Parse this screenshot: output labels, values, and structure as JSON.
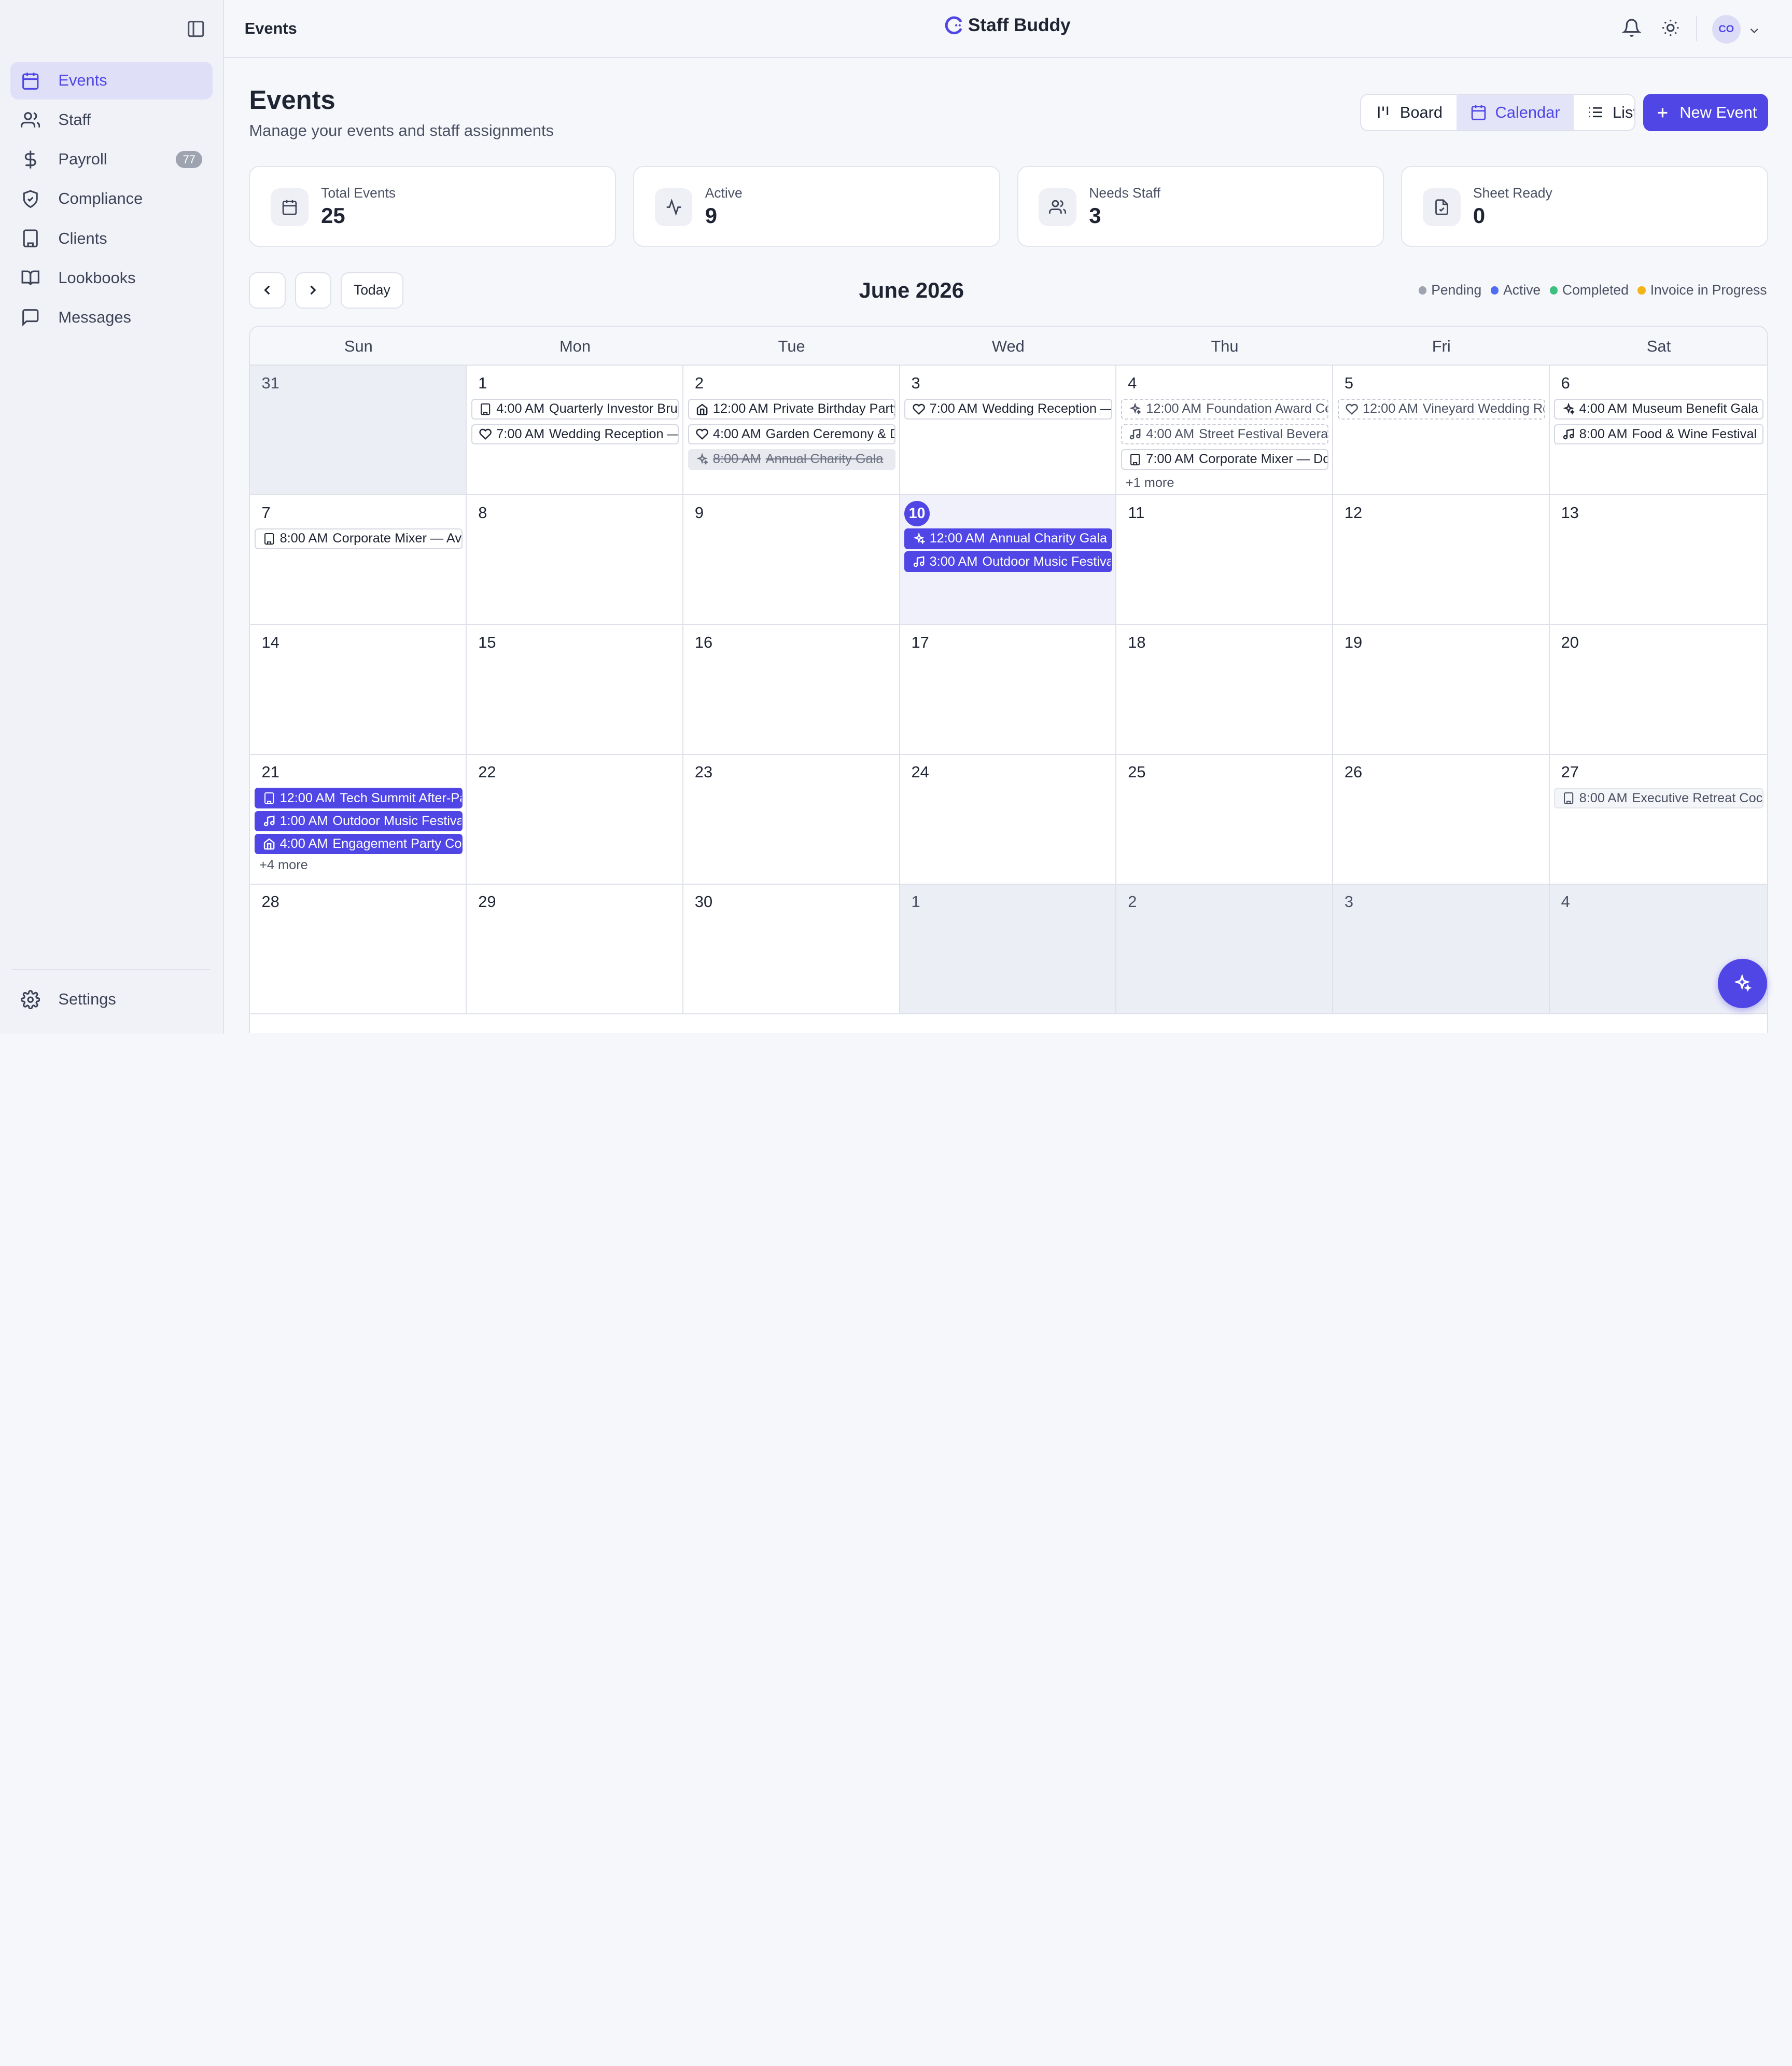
{
  "app": {
    "brand": "Staff Buddy",
    "breadcrumb": "Events",
    "user_initials": "CO"
  },
  "colors": {
    "accent": "#4f46e5",
    "pending": "#9ea3b0",
    "active": "#4f6ef5",
    "completed": "#3fbf7f",
    "invoice": "#f2b418"
  },
  "sidebar": {
    "items": [
      {
        "label": "Events",
        "icon": "calendar-icon"
      },
      {
        "label": "Staff",
        "icon": "users-icon"
      },
      {
        "label": "Payroll",
        "icon": "dollar-icon",
        "badge": "77"
      },
      {
        "label": "Compliance",
        "icon": "shield-icon"
      },
      {
        "label": "Clients",
        "icon": "building-icon"
      },
      {
        "label": "Lookbooks",
        "icon": "book-icon"
      },
      {
        "label": "Messages",
        "icon": "message-icon"
      }
    ],
    "settings_label": "Settings"
  },
  "header": {
    "title": "Events",
    "subtitle": "Manage your events and staff assignments",
    "views": [
      "Board",
      "Calendar",
      "List"
    ],
    "active_view": "Calendar",
    "new_event_label": "New Event"
  },
  "stats": [
    {
      "label": "Total Events",
      "value": "25",
      "icon": "calendar-icon"
    },
    {
      "label": "Active",
      "value": "9",
      "icon": "activity-icon"
    },
    {
      "label": "Needs Staff",
      "value": "3",
      "icon": "users-icon"
    },
    {
      "label": "Sheet Ready",
      "value": "0",
      "icon": "file-check-icon"
    }
  ],
  "calendar": {
    "month_label": "June 2026",
    "today_label": "Today",
    "legend": [
      "Pending",
      "Active",
      "Completed",
      "Invoice in Progress"
    ],
    "weekdays": [
      "Sun",
      "Mon",
      "Tue",
      "Wed",
      "Thu",
      "Fri",
      "Sat"
    ],
    "today_index": 10,
    "days": [
      {
        "n": "31",
        "muted": true,
        "events": []
      },
      {
        "n": "1",
        "events": [
          {
            "time": "4:00 AM",
            "title": "Quarterly Investor Brunch",
            "icon": "building",
            "style": "outline"
          },
          {
            "time": "7:00 AM",
            "title": "Wedding Reception — Garden",
            "icon": "heart",
            "style": "outline"
          }
        ]
      },
      {
        "n": "2",
        "events": [
          {
            "time": "12:00 AM",
            "title": "Private Birthday Party",
            "icon": "home",
            "style": "outline"
          },
          {
            "time": "4:00 AM",
            "title": "Garden Ceremony & Dinner",
            "icon": "heart",
            "style": "outline"
          },
          {
            "time": "8:00 AM",
            "title": "Annual Charity Gala",
            "icon": "sparkle",
            "style": "done"
          }
        ]
      },
      {
        "n": "3",
        "events": [
          {
            "time": "7:00 AM",
            "title": "Wedding Reception — Estate",
            "icon": "heart",
            "style": "outline"
          }
        ]
      },
      {
        "n": "4",
        "events": [
          {
            "time": "12:00 AM",
            "title": "Foundation Award Ceremony",
            "icon": "sparkle",
            "style": "pending"
          },
          {
            "time": "4:00 AM",
            "title": "Street Festival Beverage",
            "icon": "music",
            "style": "pending"
          },
          {
            "time": "7:00 AM",
            "title": "Corporate Mixer — Downtown",
            "icon": "building",
            "style": "outline"
          }
        ],
        "more": "+1 more"
      },
      {
        "n": "5",
        "events": [
          {
            "time": "12:00 AM",
            "title": "Vineyard Wedding Reception",
            "icon": "heart",
            "style": "pending"
          }
        ]
      },
      {
        "n": "6",
        "events": [
          {
            "time": "4:00 AM",
            "title": "Museum Benefit Gala",
            "icon": "sparkle",
            "style": "outline"
          },
          {
            "time": "8:00 AM",
            "title": "Food & Wine Festival",
            "icon": "music",
            "style": "outline"
          }
        ]
      },
      {
        "n": "7",
        "events": [
          {
            "time": "8:00 AM",
            "title": "Corporate Mixer — Avenue",
            "icon": "building",
            "style": "outline"
          }
        ]
      },
      {
        "n": "8",
        "events": []
      },
      {
        "n": "9",
        "events": []
      },
      {
        "n": "10",
        "today": true,
        "events": [
          {
            "time": "12:00 AM",
            "title": "Annual Charity Gala",
            "icon": "sparkle",
            "style": "active"
          },
          {
            "time": "3:00 AM",
            "title": "Outdoor Music Festival",
            "icon": "music",
            "style": "active"
          }
        ]
      },
      {
        "n": "11",
        "events": []
      },
      {
        "n": "12",
        "events": []
      },
      {
        "n": "13",
        "events": []
      },
      {
        "n": "14",
        "events": []
      },
      {
        "n": "15",
        "events": []
      },
      {
        "n": "16",
        "events": []
      },
      {
        "n": "17",
        "events": []
      },
      {
        "n": "18",
        "events": []
      },
      {
        "n": "19",
        "events": []
      },
      {
        "n": "20",
        "events": []
      },
      {
        "n": "21",
        "events": [
          {
            "time": "12:00 AM",
            "title": "Tech Summit After-Party",
            "icon": "building",
            "style": "active"
          },
          {
            "time": "1:00 AM",
            "title": "Outdoor Music Festival",
            "icon": "music",
            "style": "active"
          },
          {
            "time": "4:00 AM",
            "title": "Engagement Party Cocktails",
            "icon": "home",
            "style": "active"
          }
        ],
        "more": "+4 more"
      },
      {
        "n": "22",
        "events": []
      },
      {
        "n": "23",
        "events": []
      },
      {
        "n": "24",
        "events": []
      },
      {
        "n": "25",
        "events": []
      },
      {
        "n": "26",
        "events": []
      },
      {
        "n": "27",
        "events": [
          {
            "time": "8:00 AM",
            "title": "Executive Retreat Cocktails",
            "icon": "building",
            "style": "retreat"
          }
        ]
      },
      {
        "n": "28",
        "events": []
      },
      {
        "n": "29",
        "events": []
      },
      {
        "n": "30",
        "events": []
      },
      {
        "n": "1",
        "muted": true,
        "events": []
      },
      {
        "n": "2",
        "muted": true,
        "events": []
      },
      {
        "n": "3",
        "muted": true,
        "events": []
      },
      {
        "n": "4",
        "muted": true,
        "events": []
      }
    ]
  }
}
